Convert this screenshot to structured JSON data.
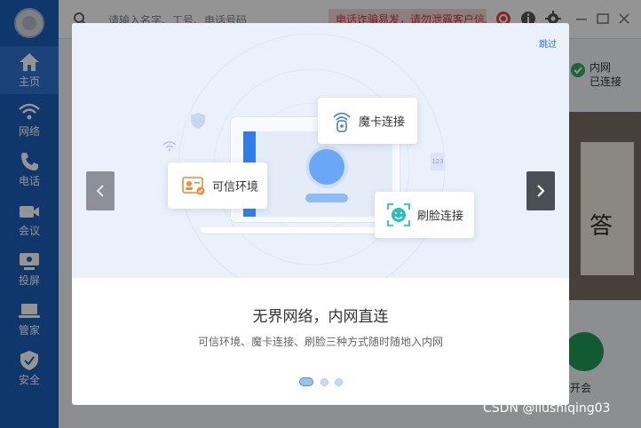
{
  "sidebar": {
    "items": [
      {
        "label": "主页",
        "icon": "home-icon"
      },
      {
        "label": "网络",
        "icon": "wifi-icon"
      },
      {
        "label": "电话",
        "icon": "phone-icon"
      },
      {
        "label": "会议",
        "icon": "video-icon"
      },
      {
        "label": "投屏",
        "icon": "cast-icon"
      },
      {
        "label": "管家",
        "icon": "laptop-icon"
      },
      {
        "label": "安全",
        "icon": "shield-icon"
      }
    ]
  },
  "topbar": {
    "search_placeholder": "请输入名字、工号、电话号码",
    "notice": "电话诈骗易发，请勿泄露客户信息"
  },
  "right_panel": {
    "network_line1": "内网",
    "network_line2": "已连接",
    "banner_glyph": "答",
    "meeting_label": "话开会"
  },
  "modal": {
    "skip_label": "跳过",
    "cards": {
      "trusted": "可信环境",
      "magic": "魔卡连接",
      "face": "刷脸连接"
    },
    "deco_badge": "123",
    "title": "无界网络，内网直连",
    "description": "可信环境、魔卡连接、刷脸三种方式随时随地入内网",
    "pager": {
      "current": 1,
      "total": 3
    }
  },
  "watermark": "CSDN @liushiqing03",
  "colors": {
    "sidebar": "#1c5fb8",
    "accent": "#2f74d0",
    "notice_text": "#d23b3b",
    "meeting_green": "#1f9d57"
  }
}
